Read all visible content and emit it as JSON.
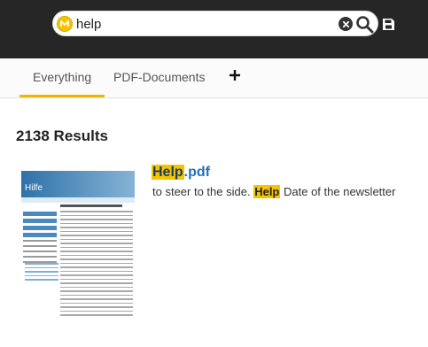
{
  "search": {
    "query": "help"
  },
  "tabs": [
    {
      "label": "Everything"
    },
    {
      "label": "PDF-Documents"
    }
  ],
  "results": {
    "count_label": "2138 Results",
    "items": [
      {
        "title_highlight": "Help",
        "title_rest": ".pdf",
        "snippet_before": "to steer to the side.",
        "snippet_highlight": "Help",
        "snippet_after": "Date of the newsletter",
        "thumbnail_title": "Hilfe"
      }
    ]
  },
  "colors": {
    "topbar": "#262626",
    "accent": "#f5c400",
    "link": "#2472b6"
  },
  "icons": [
    "logo-icon",
    "clear-icon",
    "search-icon",
    "save-icon",
    "plus-icon"
  ]
}
